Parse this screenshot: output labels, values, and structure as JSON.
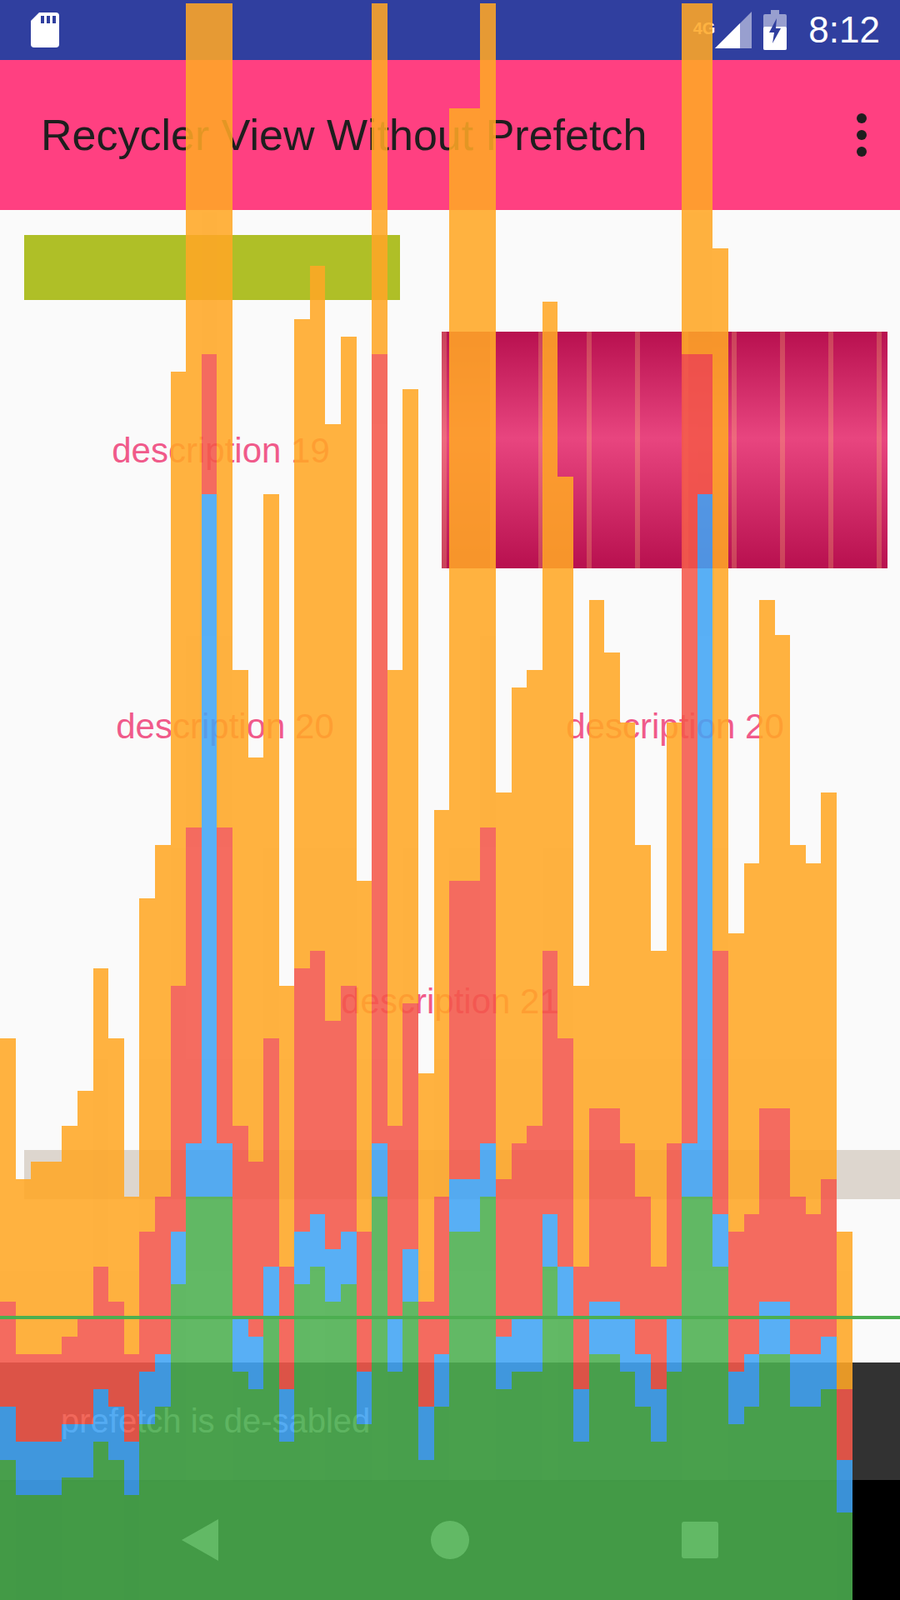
{
  "status_bar": {
    "network": "4G",
    "time": "8:12",
    "battery_charging": true
  },
  "toolbar": {
    "title": "Recycler View Without Prefetch"
  },
  "list": {
    "rows": [
      {
        "kind": "banner",
        "descriptions": [
          "description 19"
        ]
      },
      {
        "kind": "pair",
        "descriptions": [
          "description 20",
          "description 20"
        ]
      },
      {
        "kind": "single",
        "descriptions": [
          "description 21"
        ]
      },
      {
        "kind": "placeholder",
        "descriptions": []
      }
    ]
  },
  "snackbar": {
    "text": "prefetch is de-sabled"
  },
  "chart": {
    "threshold_ms": 16,
    "series": [
      {
        "color": "#4CAF50",
        "values": [
          8,
          6,
          6,
          6,
          7,
          7,
          9,
          8,
          6,
          10,
          11,
          18,
          23,
          23,
          23,
          13,
          12,
          16,
          9,
          18,
          19,
          17,
          18,
          10,
          23,
          13,
          17,
          8,
          11,
          21,
          21,
          23,
          12,
          13,
          13,
          19,
          16,
          9,
          14,
          14,
          13,
          11,
          9,
          13,
          23,
          23,
          19,
          10,
          11,
          14,
          14,
          11,
          11,
          12,
          5
        ]
      },
      {
        "color": "#42A5F5",
        "values": [
          3,
          3,
          3,
          3,
          3,
          3,
          3,
          3,
          3,
          3,
          3,
          3,
          3,
          40,
          3,
          3,
          3,
          3,
          3,
          3,
          3,
          3,
          3,
          3,
          3,
          3,
          3,
          3,
          3,
          3,
          3,
          3,
          3,
          3,
          3,
          3,
          3,
          3,
          3,
          3,
          3,
          3,
          3,
          3,
          3,
          40,
          3,
          3,
          3,
          3,
          3,
          3,
          3,
          3,
          3
        ]
      },
      {
        "color": "#F4584A",
        "values": [
          6,
          5,
          5,
          5,
          5,
          6,
          7,
          6,
          5,
          8,
          9,
          14,
          18,
          8,
          18,
          11,
          10,
          13,
          7,
          15,
          15,
          13,
          14,
          8,
          45,
          11,
          14,
          6,
          9,
          17,
          17,
          18,
          9,
          10,
          11,
          15,
          13,
          7,
          11,
          11,
          10,
          9,
          7,
          10,
          45,
          8,
          15,
          8,
          8,
          11,
          11,
          9,
          8,
          9,
          4
        ]
      },
      {
        "color": "#FFA726",
        "values": [
          15,
          10,
          11,
          11,
          12,
          13,
          17,
          15,
          9,
          19,
          20,
          35,
          47,
          20,
          47,
          26,
          23,
          31,
          16,
          37,
          39,
          34,
          37,
          20,
          20,
          26,
          35,
          13,
          22,
          44,
          44,
          47,
          22,
          26,
          26,
          37,
          32,
          16,
          29,
          26,
          24,
          20,
          18,
          24,
          20,
          20,
          40,
          17,
          20,
          29,
          27,
          20,
          20,
          22,
          9
        ]
      }
    ]
  }
}
